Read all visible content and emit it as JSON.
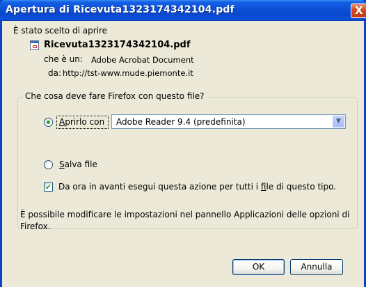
{
  "window": {
    "title": "Apertura di Ricevuta1323174342104.pdf",
    "close_glyph": "X"
  },
  "intro_text": "È stato scelto di aprire",
  "file": {
    "icon": "document-icon",
    "name": "Ricevuta1323174342104.pdf",
    "type_label": "che è un:",
    "type_value": "Adobe Acrobat Document",
    "source_label": "da:",
    "source_value": "http://tst-www.mude.piemonte.it"
  },
  "action_group": {
    "legend": "Che cosa deve fare Firefox con questo file?",
    "open_with_prefix": "",
    "open_with_access": "A",
    "open_with_rest": "prirlo con",
    "open_with_selected": true,
    "app_select_value": "Adobe Reader 9.4 (predefinita)",
    "save_access": "S",
    "save_rest": "alva file",
    "save_selected": false,
    "remember_checked": true,
    "remember_before": "Da ora in avanti esegui questa azione per tutti i ",
    "remember_access": "f",
    "remember_after": "ile di questo tipo."
  },
  "footer_note_line1": "È possibile modificare le impostazioni nel pannello Applicazioni delle opzioni di",
  "footer_note_line2": "Firefox.",
  "buttons": {
    "ok_label": "OK",
    "cancel_label": "Annulla"
  },
  "colors": {
    "titlebar": "#0a48cc",
    "dialog_bg": "#ece9d8",
    "accent_green": "#21a121"
  }
}
